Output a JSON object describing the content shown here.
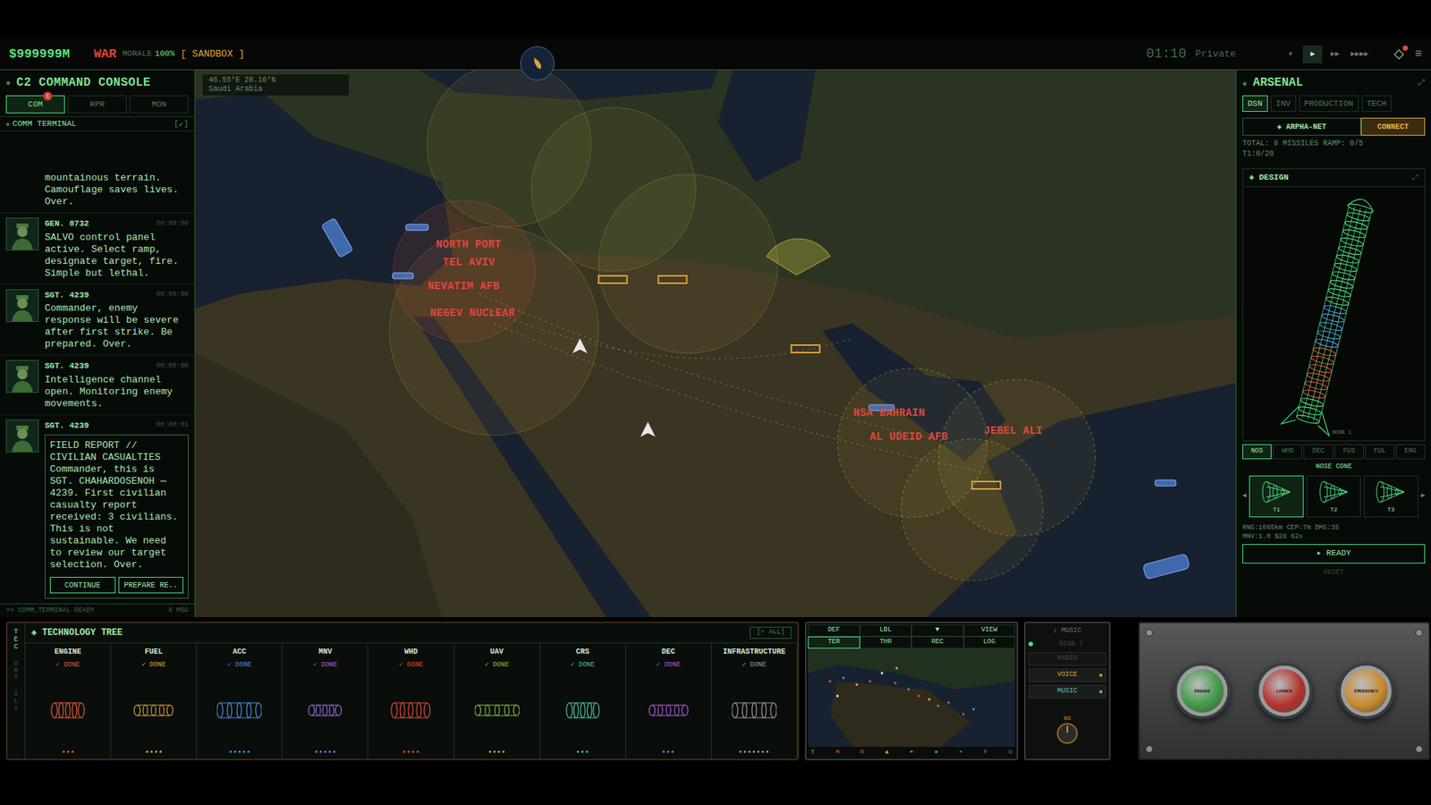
{
  "topbar": {
    "money": "$999999M",
    "mode": "WAR",
    "morale_label": "MORALE",
    "morale": "100%",
    "sandbox": "[ SANDBOX ]",
    "clock": "01:10",
    "rank": "Private",
    "speed": [
      {
        "label": "⏸",
        "selected": false
      },
      {
        "label": "▶",
        "selected": true
      },
      {
        "label": "▶▶",
        "selected": false
      },
      {
        "label": "▶▶▶▶",
        "selected": false
      }
    ],
    "menu": "≡"
  },
  "console": {
    "title": "C2 COMMAND CONSOLE",
    "tabs": [
      {
        "label": "COM",
        "selected": true,
        "badge": "1"
      },
      {
        "label": "RPR",
        "selected": false,
        "badge": ""
      },
      {
        "label": "MON",
        "selected": false,
        "badge": ""
      }
    ],
    "section": "COMM TERMINAL",
    "section_action": "[↙]",
    "messages": [
      {
        "sender": "",
        "time": "",
        "title": "",
        "text": "mountainous terrain. Camouflage saves lives. Over.",
        "report": false
      },
      {
        "sender": "GEN. 8732",
        "time": "00:00:00",
        "title": "",
        "text": "SALVO control panel active. Select ramp, designate target, fire. Simple but lethal.",
        "report": false
      },
      {
        "sender": "SGT. 4239",
        "time": "00:00:00",
        "title": "",
        "text": "Commander, enemy response will be severe after first strike. Be prepared. Over.",
        "report": false
      },
      {
        "sender": "SGT. 4239",
        "time": "00:00:00",
        "title": "",
        "text": "Intelligence channel open. Monitoring enemy movements.",
        "report": false
      },
      {
        "sender": "SGT. 4239",
        "time": "00:00:01",
        "title": "FIELD REPORT // CIVILIAN CASUALTIES",
        "text": "Commander, this is SGT. CHAHARDOSENOH — 4239. First civilian casualty report received: 3 civilians. This is not sustainable. We need to review our target selection. Over.",
        "report": true
      }
    ],
    "actions": [
      "CONTINUE",
      "PREPARE RE.."
    ],
    "status": ">> COMM_TERMINAL READY",
    "count": "6 MSG"
  },
  "map": {
    "coords": "46.55°E 28.16°N",
    "region": "Saudi Arabia",
    "labels": [
      "NORTH PORT",
      "TEL AVIV",
      "NEVATIM AFB",
      "NEGEV NUCLEAR",
      "NSA BAHRAIN",
      "AL UDEID AFB",
      "JEBEL ALI"
    ]
  },
  "arsenal": {
    "title": "ARSENAL",
    "expand": "⤢",
    "tabs": [
      {
        "label": "DSN",
        "selected": true
      },
      {
        "label": "INV",
        "selected": false
      },
      {
        "label": "PRODUCTION",
        "selected": false
      },
      {
        "label": "TECH",
        "selected": false
      }
    ],
    "network": "◈ ARPHA-NET",
    "connect": "CONNECT",
    "totals": "TOTAL: 0 MISSILES RAMP: 0/5",
    "tier": "T1:0/20",
    "design": "◈ DESIGN",
    "design_expand": "⤢",
    "part_caption": "NOSE 1",
    "parts": [
      {
        "label": "NOS",
        "selected": true
      },
      {
        "label": "WHD",
        "selected": false
      },
      {
        "label": "DEC",
        "selected": false
      },
      {
        "label": "FUS",
        "selected": false
      },
      {
        "label": "FUL",
        "selected": false
      },
      {
        "label": "ENG",
        "selected": false
      }
    ],
    "part_title": "NOSE CONE",
    "prev": "◀",
    "next": "▶",
    "options": [
      {
        "label": "T1",
        "selected": true
      },
      {
        "label": "T2",
        "selected": false
      },
      {
        "label": "T3",
        "selected": false
      }
    ],
    "stats": [
      "RNG:1665km CEP:7m DMG:35",
      "MNV:1.0 $28 62s"
    ],
    "ready": "▸ READY",
    "reset": "RESET"
  },
  "tech": {
    "title": "◈ TECHNOLOGY TREE",
    "all": "[+ ALL]",
    "side_tabs": [
      {
        "label": "TEC",
        "selected": true
      },
      {
        "label": "URT",
        "selected": false
      },
      {
        "label": "ILT",
        "selected": false
      }
    ],
    "items": [
      {
        "name": "ENGINE",
        "status": "✓ DONE",
        "stars": 3,
        "color": "#e0593a"
      },
      {
        "name": "FUEL",
        "status": "✓ DONE",
        "stars": 4,
        "color": "#e0a23a"
      },
      {
        "name": "ACC",
        "status": "✓ DONE",
        "stars": 5,
        "color": "#4a8fe0"
      },
      {
        "name": "MNV",
        "status": "✓ DONE",
        "stars": 5,
        "color": "#9a6ae0"
      },
      {
        "name": "WHD",
        "status": "✓ DONE",
        "stars": 4,
        "color": "#e04a3a"
      },
      {
        "name": "UAV",
        "status": "✓ DONE",
        "stars": 4,
        "color": "#8ac048"
      },
      {
        "name": "CRS",
        "status": "✓ DONE",
        "stars": 3,
        "color": "#48c0a8"
      },
      {
        "name": "DEC",
        "status": "✓ DONE",
        "stars": 3,
        "color": "#b45ae0"
      },
      {
        "name": "INFRASTRUCTURE",
        "status": "✓ DONE",
        "stars": 7,
        "color": "#9a9a9a"
      }
    ]
  },
  "minimap": {
    "tabs": [
      {
        "label": "DEF",
        "selected": false
      },
      {
        "label": "LBL",
        "selected": false
      },
      {
        "label": "▼",
        "selected": false
      },
      {
        "label": "VIEW",
        "selected": false
      }
    ],
    "subtabs": [
      {
        "label": "TER",
        "selected": true
      },
      {
        "label": "THR",
        "selected": false
      },
      {
        "label": "REC",
        "selected": false
      },
      {
        "label": "LOG",
        "selected": false
      }
    ],
    "legend": [
      {
        "label": "T",
        "color": "#4ade80"
      },
      {
        "label": "M",
        "color": "#e04a3a"
      },
      {
        "label": "R",
        "color": "#e04a3a"
      },
      {
        "label": "▲",
        "color": "#e0a23a"
      },
      {
        "label": "+",
        "color": "#e0e0e0"
      },
      {
        "label": "●",
        "color": "#4a8fe0"
      },
      {
        "label": "+",
        "color": "#4ade80"
      },
      {
        "label": "F",
        "color": "#9a6ae0"
      },
      {
        "label": "⊡",
        "color": "#6b7b6e"
      }
    ]
  },
  "radio": {
    "title": "♪ MUSIC",
    "freq": "5530.7",
    "buttons": [
      {
        "label": "RADIO",
        "on": false,
        "color": "#4a4a4a"
      },
      {
        "label": "VOICE",
        "on": true,
        "color": "#d6a63a"
      },
      {
        "label": "MUSIC",
        "on": true,
        "color": "#5cc0c0"
      }
    ],
    "knob": "NS"
  },
  "launch": {
    "buttons": [
      {
        "label": "ENGAGE",
        "color": "#3f9a46"
      },
      {
        "label": "LAUNCH",
        "color": "#b4312c"
      },
      {
        "label": "EMERGENCY",
        "color": "#c98a2a"
      }
    ]
  }
}
